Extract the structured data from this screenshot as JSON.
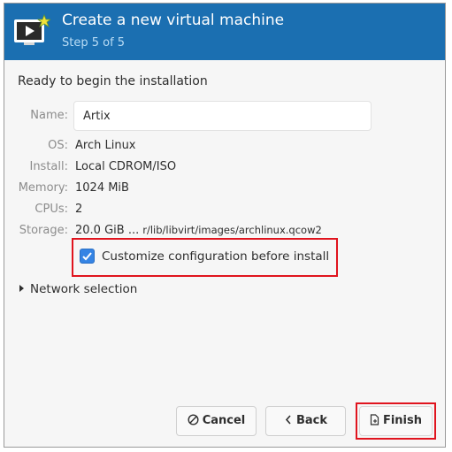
{
  "header": {
    "title": "Create a new virtual machine",
    "subtitle": "Step 5 of 5",
    "icon": "virtual-machine-icon"
  },
  "summary": {
    "heading": "Ready to begin the installation",
    "name_label": "Name:",
    "name_value": "Artix",
    "os_label": "OS:",
    "os_value": "Arch Linux",
    "install_label": "Install:",
    "install_value": "Local CDROM/ISO",
    "memory_label": "Memory:",
    "memory_value": "1024 MiB",
    "cpus_label": "CPUs:",
    "cpus_value": "2",
    "storage_label": "Storage:",
    "storage_size": "20.0 GiB ...",
    "storage_path": "r/lib/libvirt/images/archlinux.qcow2"
  },
  "customize": {
    "label": "Customize configuration before install",
    "checked": true
  },
  "network": {
    "label": "Network selection",
    "expanded": false
  },
  "buttons": {
    "cancel": "Cancel",
    "back": "Back",
    "finish": "Finish"
  },
  "colors": {
    "header_bg": "#1b6fb1",
    "checkbox_accent": "#3584e4",
    "highlight": "#e0141e"
  }
}
